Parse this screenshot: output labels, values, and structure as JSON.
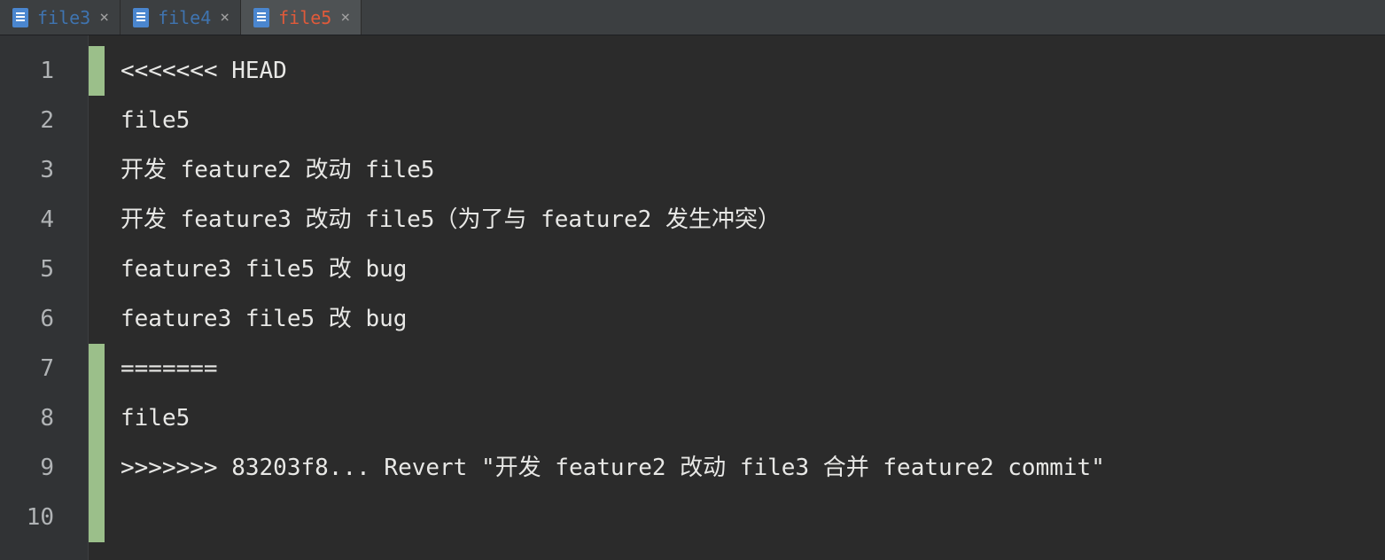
{
  "tabs": {
    "items": [
      {
        "label": "file3",
        "active": false
      },
      {
        "label": "file4",
        "active": false
      },
      {
        "label": "file5",
        "active": true
      }
    ]
  },
  "editor": {
    "lines": [
      {
        "num": "1",
        "text": "<<<<<<< HEAD",
        "changed": true
      },
      {
        "num": "2",
        "text": "file5",
        "changed": false
      },
      {
        "num": "3",
        "text": "开发 feature2 改动 file5",
        "changed": false
      },
      {
        "num": "4",
        "text": "开发 feature3 改动 file5（为了与 feature2 发生冲突）",
        "changed": false
      },
      {
        "num": "5",
        "text": "feature3 file5 改 bug",
        "changed": false
      },
      {
        "num": "6",
        "text": "feature3 file5 改 bug",
        "changed": false
      },
      {
        "num": "7",
        "text": "=======",
        "changed": true
      },
      {
        "num": "8",
        "text": "file5",
        "changed": true
      },
      {
        "num": "9",
        "text": ">>>>>>> 83203f8... Revert \"开发 feature2 改动 file3 合并 feature2 commit\"",
        "changed": true
      },
      {
        "num": "10",
        "text": "",
        "changed": true
      }
    ]
  }
}
